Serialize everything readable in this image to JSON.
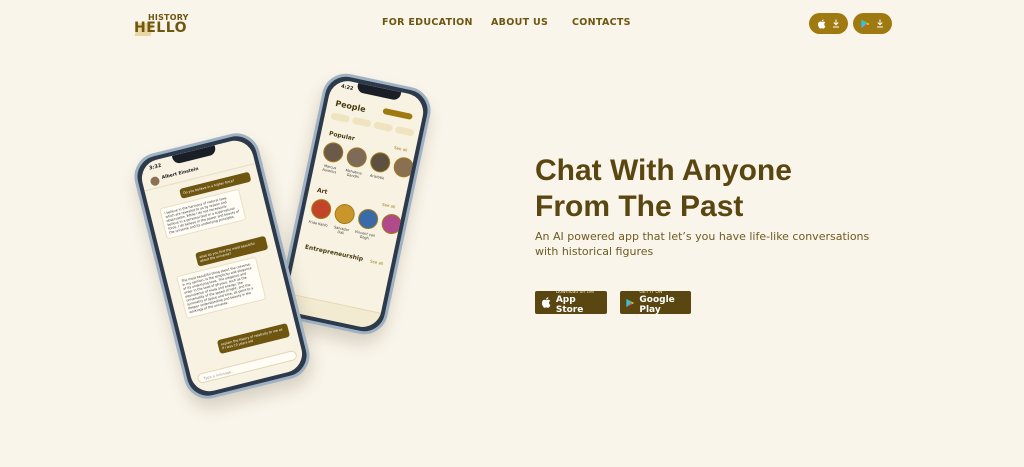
{
  "brand": {
    "logo_top": "HISTORY",
    "logo_main": "HELLO"
  },
  "nav": {
    "education": "FOR EDUCATION",
    "about": "ABOUT US",
    "contacts": "CONTACTS"
  },
  "header_downloads": {
    "apple_icon": "apple-icon",
    "play_icon": "google-play-icon",
    "download_icon": "download-arrow-icon"
  },
  "hero": {
    "title": "Chat With Anyone From The Past",
    "subtitle": "An AI powered app that let’s you have life-like conversations with historical figures"
  },
  "stores": {
    "apple": {
      "small": "Download on the",
      "big": "App Store"
    },
    "google": {
      "small": "GET IT ON",
      "big": "Google Play"
    }
  },
  "phone_people": {
    "time": "4:22",
    "title": "People",
    "popular": "Popular",
    "art": "Art",
    "entrepreneurship": "Entrepreneurship",
    "see_all": "See all",
    "popular_names": [
      "Marcus Aurelius",
      "Mahatma Gandhi",
      "Aristotle"
    ],
    "art_names": [
      "Frida Kahlo",
      "Salvador Dali",
      "Vincent van Gogh"
    ]
  },
  "phone_chat": {
    "time": "3:32",
    "contact": "Albert Einstein",
    "msg1": "Do you believe in a higher force?",
    "msg2": "I believe in the harmony of natural laws, which are revealed to us by reason and observation. While I do not necessarily believe in a personal God or a supernatural force, I do believe in the power and beauty of the universe and its underlying principles.",
    "msg3": "what do you find the most beautiful about the universe?",
    "msg4": "The most beautiful thing about the universe, in my opinion, is the simplicity and elegance of its underlying laws. The elegance and order in the laws of physics, such as the equivalence of mass and energy, the universality of the speed of light, and the symmetry of space and time, all point to a deeper understanding and beauty in the workings of the universe.",
    "msg5": "explain the theory of relativity to me as if I was 10 years old",
    "input_placeholder": "Type a message..."
  },
  "colors": {
    "background": "#faf5ea",
    "brand_brown": "#5a4610",
    "accent_gold": "#9f7a11"
  }
}
